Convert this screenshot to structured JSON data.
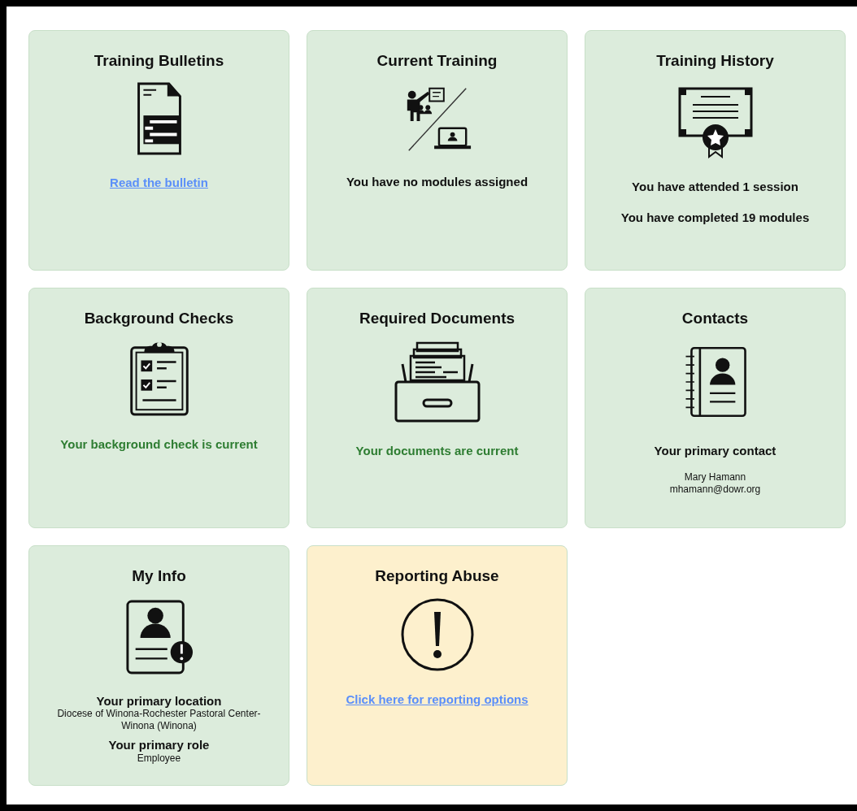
{
  "tiles": [
    {
      "title": "Training Bulletins",
      "color": "#dcecdc",
      "lines": [
        {
          "kind": "link",
          "text": "Read the bulletin"
        }
      ]
    },
    {
      "title": "Current Training",
      "color": "#dcecdc",
      "lines": [
        {
          "kind": "text",
          "text": "You have no modules assigned"
        }
      ]
    },
    {
      "title": "Training History",
      "color": "#dcecdc",
      "lines": [
        {
          "kind": "text",
          "text": "You have attended 1 session"
        },
        {
          "kind": "text",
          "text": "You have completed 19 modules"
        }
      ]
    },
    {
      "title": "Background Checks",
      "color": "#dcecdc",
      "lines": [
        {
          "kind": "status",
          "text": "Your background check is current"
        }
      ]
    },
    {
      "title": "Required Documents",
      "color": "#dcecdc",
      "lines": [
        {
          "kind": "status",
          "text": "Your documents are current"
        }
      ]
    },
    {
      "title": "Contacts",
      "color": "#dcecdc",
      "lines": [
        {
          "kind": "text",
          "text": "Your primary contact"
        },
        {
          "kind": "detail",
          "text": "Mary Hamann"
        },
        {
          "kind": "detail",
          "text": "mhamann@dowr.org"
        }
      ]
    },
    {
      "title": "My Info",
      "color": "#dcecdc",
      "lines": [
        {
          "kind": "heading",
          "text": "Your primary location"
        },
        {
          "kind": "detail",
          "text": "Diocese of Winona-Rochester Pastoral Center-Winona (Winona)"
        },
        {
          "kind": "heading",
          "text": "Your primary role"
        },
        {
          "kind": "detail",
          "text": "Employee"
        }
      ]
    },
    {
      "title": "Reporting Abuse",
      "color": "#fdf0cd",
      "lines": [
        {
          "kind": "link",
          "text": "Click here for reporting options"
        }
      ]
    }
  ]
}
